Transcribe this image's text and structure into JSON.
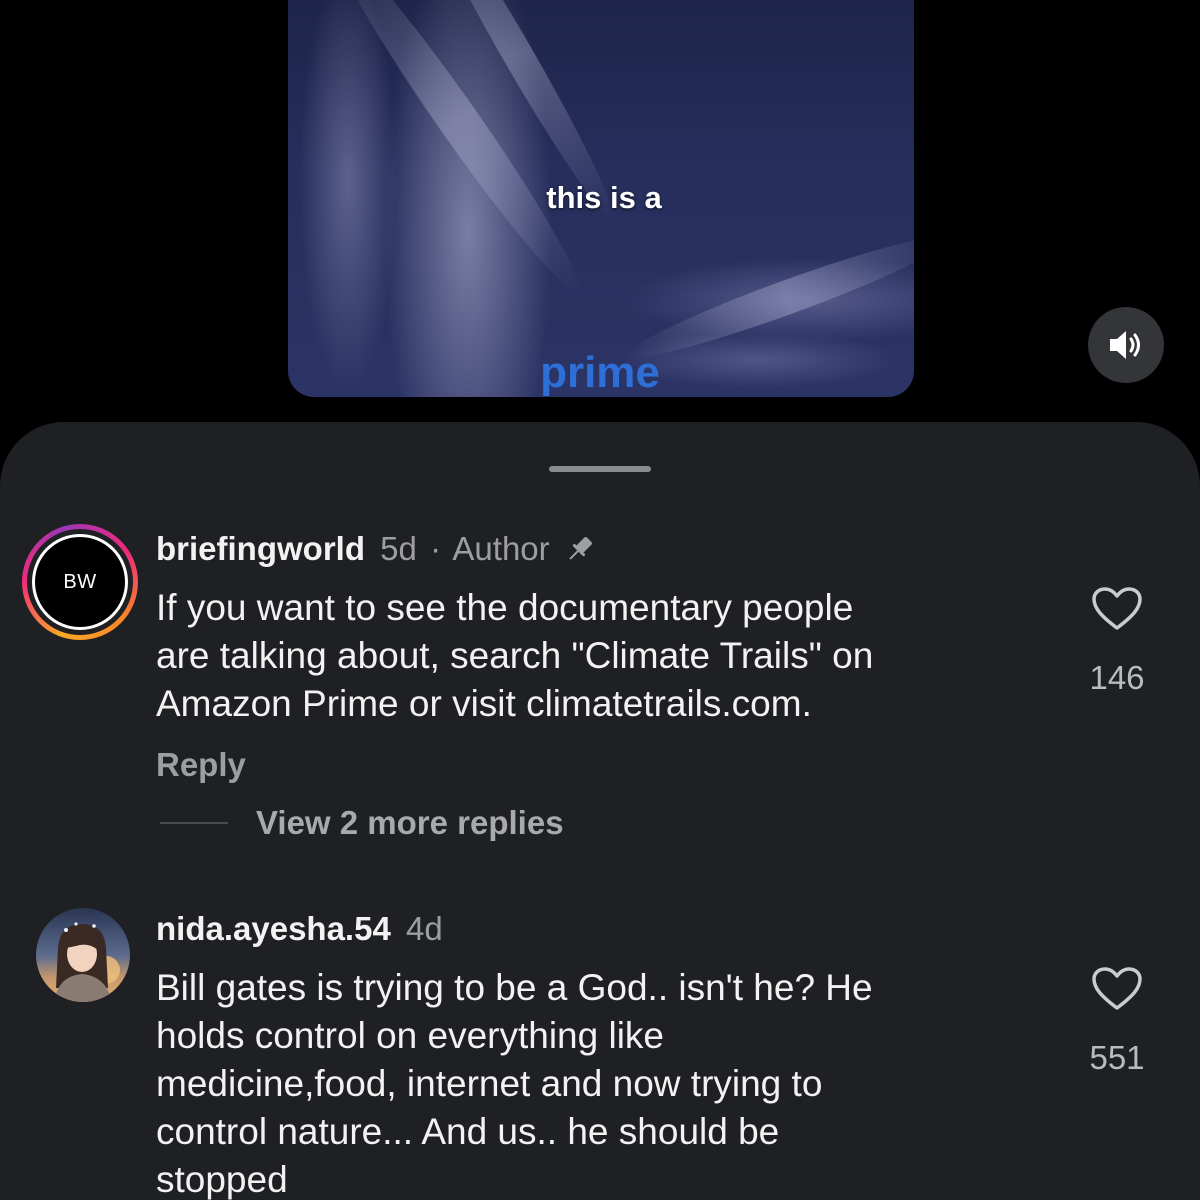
{
  "video": {
    "caption_line1": "this is a",
    "caption_line2": "prime"
  },
  "sound_button": {
    "icon": "speaker-on-icon"
  },
  "comments": [
    {
      "username": "briefingworld",
      "time": "5d",
      "separator": "·",
      "badge": "Author",
      "pinned_icon": "pin-icon",
      "avatar_text": "BW",
      "text": "If you want to see the documentary people\nare talking about, search \"Climate Trails\" on\nAmazon Prime or visit climatetrails.com.",
      "likes": "146",
      "reply_label": "Reply",
      "view_more_label": "View 2 more replies"
    },
    {
      "username": "nida.ayesha.54",
      "time": "4d",
      "text": "Bill gates is trying to be a God.. isn't he? He\nholds control on everything like\nmedicine,food, internet and now trying to\ncontrol nature... And us.. he should be\nstopped",
      "likes": "551"
    }
  ],
  "colors": {
    "sheet_bg": "#1f2023",
    "muted_text": "#9c9ea3",
    "story_ring_start": "#f9a825",
    "story_ring_mid": "#ee2a7b",
    "story_ring_end": "#9b36b7"
  }
}
